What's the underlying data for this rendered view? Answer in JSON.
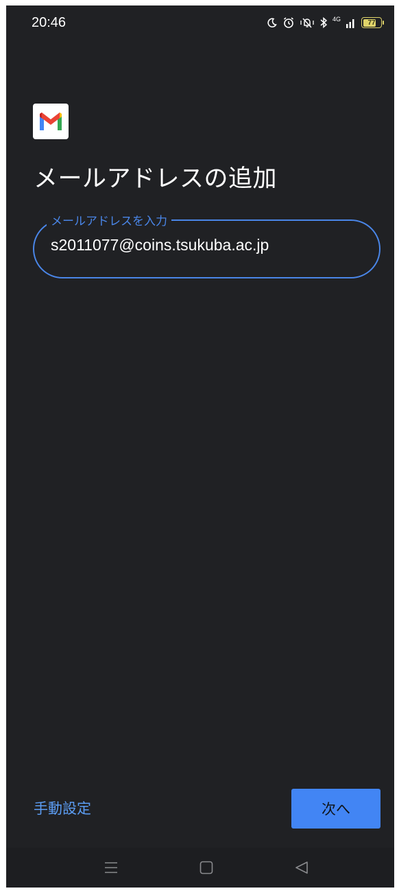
{
  "status_bar": {
    "time": "20:46",
    "network": "4G",
    "battery_level": "77",
    "battery_fraction": 0.77,
    "icons": [
      "moon-icon",
      "alarm-icon",
      "vibrate-icon",
      "bluetooth-icon",
      "signal-icon",
      "battery-icon"
    ]
  },
  "app": {
    "logo": "gmail-logo",
    "title": "メールアドレスの追加"
  },
  "email_field": {
    "label": "メールアドレスを入力",
    "value": "s2011077@coins.tsukuba.ac.jp"
  },
  "actions": {
    "manual_setup": "手動設定",
    "next": "次へ"
  },
  "nav_bar": {
    "icons": [
      "menu-icon",
      "home-icon",
      "back-icon"
    ]
  },
  "colors": {
    "background": "#202124",
    "accent": "#4285f4",
    "link": "#5b9cf2",
    "battery": "#e0d46a"
  }
}
